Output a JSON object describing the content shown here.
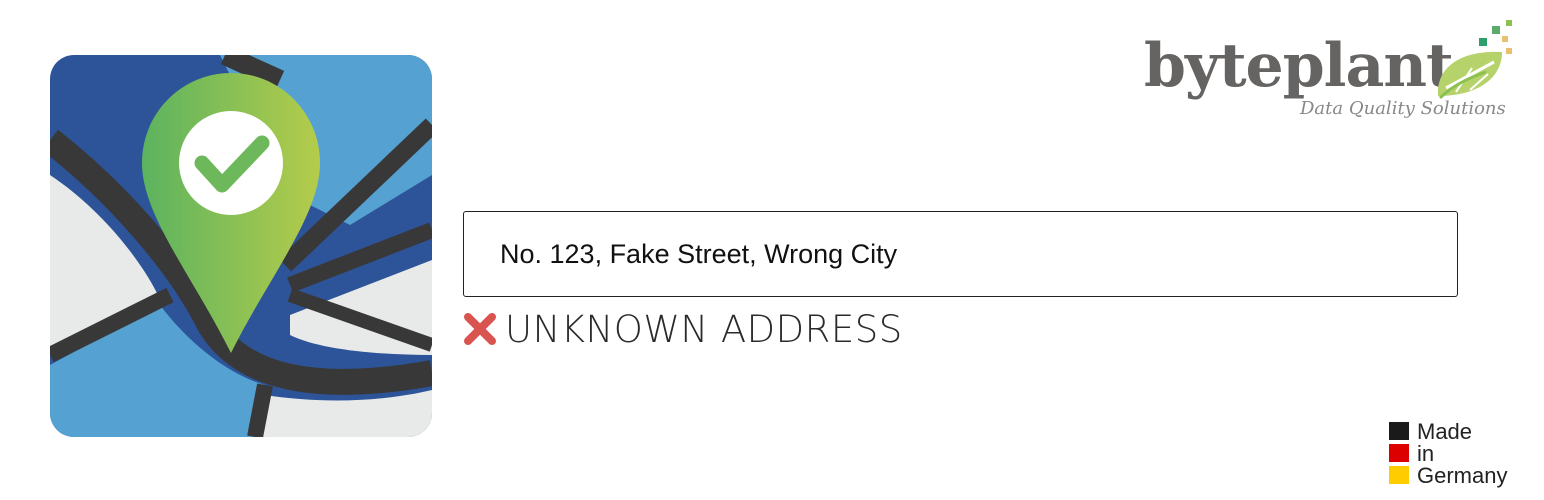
{
  "address_input": {
    "value": "No. 123, Fake Street, Wrong City"
  },
  "result": {
    "icon": "cross-icon",
    "status_text": "UNKNOWN ADDRESS",
    "status_color": "#d9534f"
  },
  "brand": {
    "name": "byteplant",
    "tagline": "Data Quality Solutions",
    "accent_color": "#8cc152",
    "text_color": "#666462"
  },
  "app_icon": {
    "icon": "map-pin-check-icon",
    "pin_gradient": [
      "#5cb35f",
      "#b5cc4a"
    ],
    "map_colors": [
      "#2d5499",
      "#55a2d2",
      "#e8eaea",
      "#383838"
    ]
  },
  "made_in": {
    "line1": "Made",
    "line2": "in",
    "line3": "Germany",
    "flag_colors": [
      "#1a1a1a",
      "#dd0000",
      "#ffcc00"
    ]
  }
}
